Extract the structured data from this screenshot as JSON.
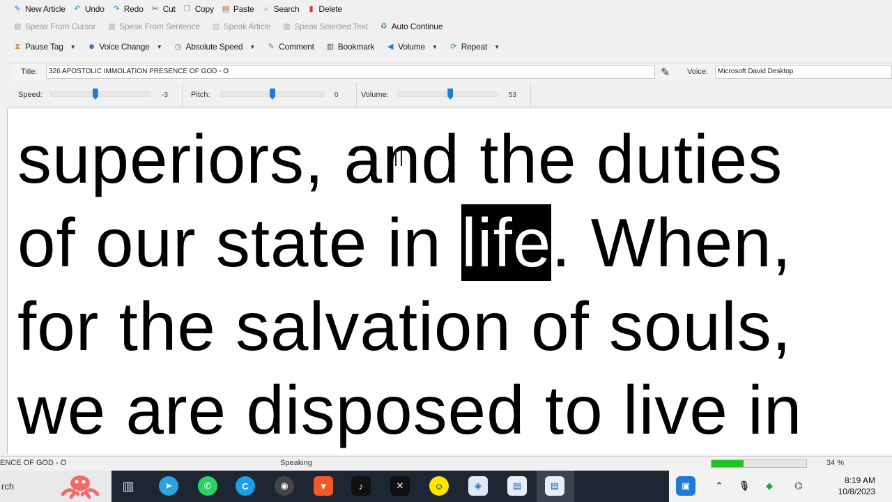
{
  "toolbar": {
    "row1": [
      {
        "label": "New Article",
        "icon": "pencil-icon"
      },
      {
        "label": "Undo",
        "icon": "undo-icon"
      },
      {
        "label": "Redo",
        "icon": "redo-icon"
      },
      {
        "label": "Cut",
        "icon": "scissors-icon"
      },
      {
        "label": "Copy",
        "icon": "copy-icon"
      },
      {
        "label": "Paste",
        "icon": "paste-icon"
      },
      {
        "label": "Search",
        "icon": "search-icon"
      },
      {
        "label": "Delete",
        "icon": "delete-icon"
      }
    ],
    "row2": [
      {
        "label": "Speak From Cursor",
        "icon": "speak-cursor-icon",
        "disabled": true
      },
      {
        "label": "Speak From Sentence",
        "icon": "speak-sentence-icon",
        "disabled": true
      },
      {
        "label": "Speak Article",
        "icon": "speak-article-icon",
        "disabled": true
      },
      {
        "label": "Speak Selected Text",
        "icon": "speak-selected-icon",
        "disabled": true
      },
      {
        "label": "Auto Continue",
        "icon": "auto-continue-icon",
        "disabled": false
      }
    ],
    "row3": [
      {
        "label": "Pause Tag",
        "icon": "pause-tag-icon",
        "dropdown": true
      },
      {
        "label": "Voice Change",
        "icon": "voice-change-icon",
        "dropdown": true
      },
      {
        "label": "Absolute Speed",
        "icon": "speed-icon",
        "dropdown": true
      },
      {
        "label": "Comment",
        "icon": "comment-icon",
        "dropdown": false
      },
      {
        "label": "Bookmark",
        "icon": "bookmark-icon",
        "dropdown": false
      },
      {
        "label": "Volume",
        "icon": "speaker-icon",
        "dropdown": true
      },
      {
        "label": "Repeat",
        "icon": "repeat-icon",
        "dropdown": true
      }
    ]
  },
  "title_bar": {
    "title_label": "Title:",
    "title_value": "326 APOSTOLIC IMMOLATION PRESENCE OF GOD - O",
    "voice_label": "Voice:",
    "voice_value": "Microsoft David Desktop"
  },
  "sliders": {
    "speed": {
      "label": "Speed:",
      "value": "-3",
      "level": 0.45
    },
    "pitch": {
      "label": "Pitch:",
      "value": "0",
      "level": 0.5
    },
    "volume": {
      "label": "Volume:",
      "value": "53",
      "level": 0.53
    }
  },
  "text": {
    "line1": "superiors, and the duties",
    "line2_before": "of our state in ",
    "line2_highlight": "life",
    "line2_after": ". When,",
    "line3": "for the salvation of souls,",
    "line4": "we are disposed to live in"
  },
  "status": {
    "article": "ENCE OF GOD - O",
    "state": "Speaking",
    "progress_percent": 34,
    "progress_text": "34 %"
  },
  "taskbar": {
    "search_text": "rch",
    "time": "8:19 AM",
    "date": "10/8/2023"
  },
  "colors": {
    "accent": "#1e7ad4",
    "progress": "#22c122",
    "taskbar": "#1f2633"
  }
}
